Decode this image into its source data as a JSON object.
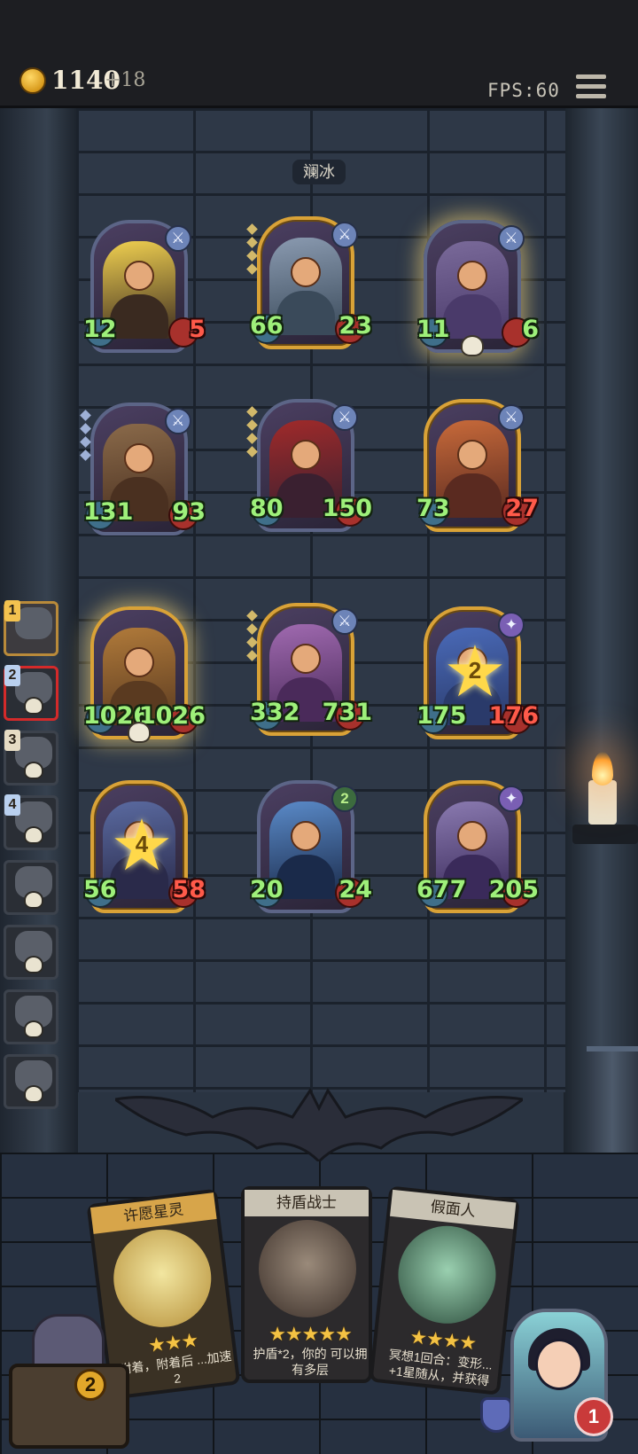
{
  "topbar": {
    "gold": "1140",
    "gold_income": "+18",
    "fps": "FPS:60",
    "menu_icon": "hamburger-menu-icon"
  },
  "board": {
    "title": "斓冰",
    "units": [
      {
        "atk": "12",
        "hp": "5",
        "hp_style": "red",
        "badge": "sword",
        "frame": "silver",
        "portrait": "bearded-warrior-flames",
        "skull": false
      },
      {
        "atk": "66",
        "hp": "23",
        "hp_style": "green",
        "badge": "sword",
        "frame": "gold",
        "portrait": "helmet-guard",
        "skull": false
      },
      {
        "atk": "11",
        "hp": "6",
        "hp_style": "green",
        "badge": "sword",
        "frame": "silver-glow",
        "portrait": "old-bearded-man",
        "skull": true
      },
      {
        "atk": "131",
        "hp": "93",
        "hp_style": "green",
        "badge": "sword",
        "frame": "silver",
        "portrait": "cowboy-bandit",
        "skull": false
      },
      {
        "atk": "80",
        "hp": "150",
        "hp_style": "green",
        "badge": "sword",
        "frame": "silver",
        "portrait": "masked-knight",
        "skull": false
      },
      {
        "atk": "73",
        "hp": "27",
        "hp_style": "red",
        "badge": "sword",
        "frame": "gold",
        "portrait": "blonde-brawler",
        "skull": false
      },
      {
        "atk": "1026",
        "hp": "1026",
        "hp_style": "green",
        "badge": "none",
        "frame": "gold-glow",
        "portrait": "archer-with-bow",
        "skull": true
      },
      {
        "atk": "332",
        "hp": "731",
        "hp_style": "green",
        "badge": "sword",
        "frame": "gold",
        "portrait": "mad-scientist",
        "skull": false
      },
      {
        "atk": "175",
        "hp": "176",
        "hp_style": "red",
        "badge": "star",
        "frame": "gold",
        "portrait": "star-sorcerer",
        "star": "2",
        "skull": false
      },
      {
        "atk": "56",
        "hp": "58",
        "hp_style": "red",
        "badge": "none",
        "frame": "gold",
        "portrait": "winged-elf",
        "star": "4",
        "skull": false
      },
      {
        "atk": "20",
        "hp": "24",
        "hp_style": "green",
        "badge": "2",
        "frame": "silver",
        "portrait": "frost-beast",
        "skull": false
      },
      {
        "atk": "677",
        "hp": "205",
        "hp_style": "green",
        "badge": "star",
        "frame": "gold",
        "portrait": "bearded-king",
        "skull": false
      }
    ]
  },
  "roster": [
    {
      "num": "1",
      "state": "active"
    },
    {
      "num": "2",
      "state": "selected"
    },
    {
      "num": "3",
      "state": "dead"
    },
    {
      "num": "4",
      "state": "dead"
    },
    {
      "num": "",
      "state": "dead"
    },
    {
      "num": "",
      "state": "dead"
    },
    {
      "num": "",
      "state": "dead"
    },
    {
      "num": "",
      "state": "dead"
    }
  ],
  "hand": [
    {
      "name": "许愿星灵",
      "stars": "★★★",
      "desc": "附着，附着后 ...加速2",
      "banner_color": "#d7a54a",
      "art": "wish-star-sprite"
    },
    {
      "name": "持盾战士",
      "stars": "★★★★★",
      "desc": "护盾*2，你的 可以拥有多层",
      "banner_color": "#c9c3b4",
      "art": "shield-warrior"
    },
    {
      "name": "假面人",
      "stars": "★★★★",
      "desc": "冥想1回合：变形... +1星随从，并获得",
      "banner_color": "#c9c3b4",
      "art": "masked-man"
    }
  ],
  "player": {
    "lives": "1",
    "chest_count": "2"
  }
}
